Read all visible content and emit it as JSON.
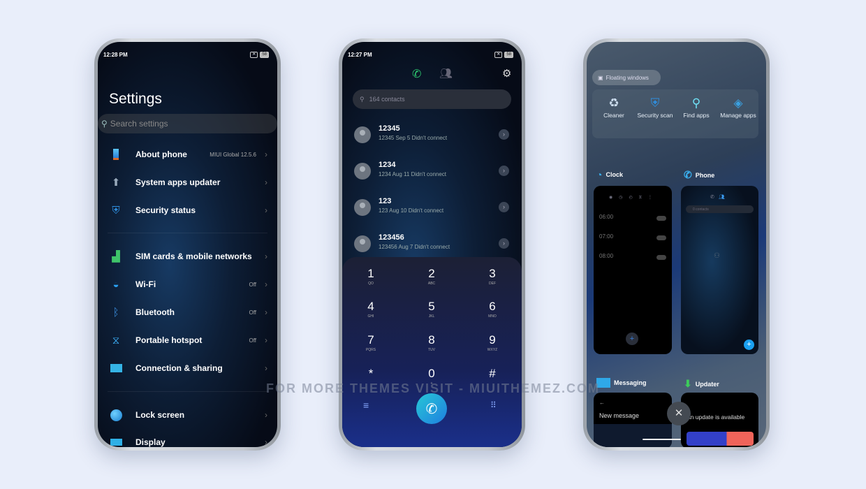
{
  "watermark": "FOR MORE THEMES VISIT - MIUITHEMEZ.COM",
  "settings": {
    "status": {
      "time": "12:28 PM",
      "battery": "58"
    },
    "title": "Settings",
    "search_placeholder": "Search settings",
    "items": [
      {
        "label": "About phone",
        "value": "MIUI Global 12.5.6",
        "icon": "phone-icon"
      },
      {
        "label": "System apps updater",
        "value": "",
        "icon": "updater-icon"
      },
      {
        "label": "Security status",
        "value": "",
        "icon": "shield-icon"
      },
      {
        "label": "SIM cards & mobile networks",
        "value": "",
        "icon": "signal-icon"
      },
      {
        "label": "Wi-Fi",
        "value": "Off",
        "icon": "wifi-icon"
      },
      {
        "label": "Bluetooth",
        "value": "Off",
        "icon": "bluetooth-icon"
      },
      {
        "label": "Portable hotspot",
        "value": "Off",
        "icon": "hotspot-icon"
      },
      {
        "label": "Connection & sharing",
        "value": "",
        "icon": "monitor-icon"
      },
      {
        "label": "Lock screen",
        "value": "",
        "icon": "lock-screen-icon"
      },
      {
        "label": "Display",
        "value": "",
        "icon": "display-icon"
      }
    ]
  },
  "dialer": {
    "status": {
      "time": "12:27 PM",
      "battery": "58"
    },
    "search_placeholder": "164 contacts",
    "calls": [
      {
        "name": "12345",
        "detail": "12345  Sep 5 Didn't connect"
      },
      {
        "name": "1234",
        "detail": "1234  Aug 11 Didn't connect"
      },
      {
        "name": "123",
        "detail": "123  Aug 10 Didn't connect"
      },
      {
        "name": "123456",
        "detail": "123456  Aug 7 Didn't connect"
      }
    ],
    "keys": [
      {
        "d": "1",
        "l": "QO"
      },
      {
        "d": "2",
        "l": "ABC"
      },
      {
        "d": "3",
        "l": "DEF"
      },
      {
        "d": "4",
        "l": "GHI"
      },
      {
        "d": "5",
        "l": "JKL"
      },
      {
        "d": "6",
        "l": "MNO"
      },
      {
        "d": "7",
        "l": "PQRS"
      },
      {
        "d": "8",
        "l": "TUV"
      },
      {
        "d": "9",
        "l": "WXYZ"
      },
      {
        "d": "*",
        "l": ""
      },
      {
        "d": "0",
        "l": "+"
      },
      {
        "d": "#",
        "l": ""
      }
    ],
    "call_color": "#1fb5d8"
  },
  "recents": {
    "floating_windows": "Floating windows",
    "shortcuts": [
      {
        "label": "Cleaner",
        "icon": "cleaner-icon"
      },
      {
        "label": "Security scan",
        "icon": "security-scan-icon"
      },
      {
        "label": "Find apps",
        "icon": "search-icon"
      },
      {
        "label": "Manage apps",
        "icon": "manage-apps-icon"
      }
    ],
    "apps": {
      "clock": {
        "name": "Clock",
        "alarms": [
          {
            "time": "06:00"
          },
          {
            "time": "07:00"
          },
          {
            "time": "08:00"
          }
        ]
      },
      "phone": {
        "name": "Phone",
        "search": "0 contacts"
      },
      "messaging": {
        "name": "Messaging",
        "title": "New message"
      },
      "updater": {
        "name": "Updater",
        "title": "An update is available"
      }
    }
  }
}
